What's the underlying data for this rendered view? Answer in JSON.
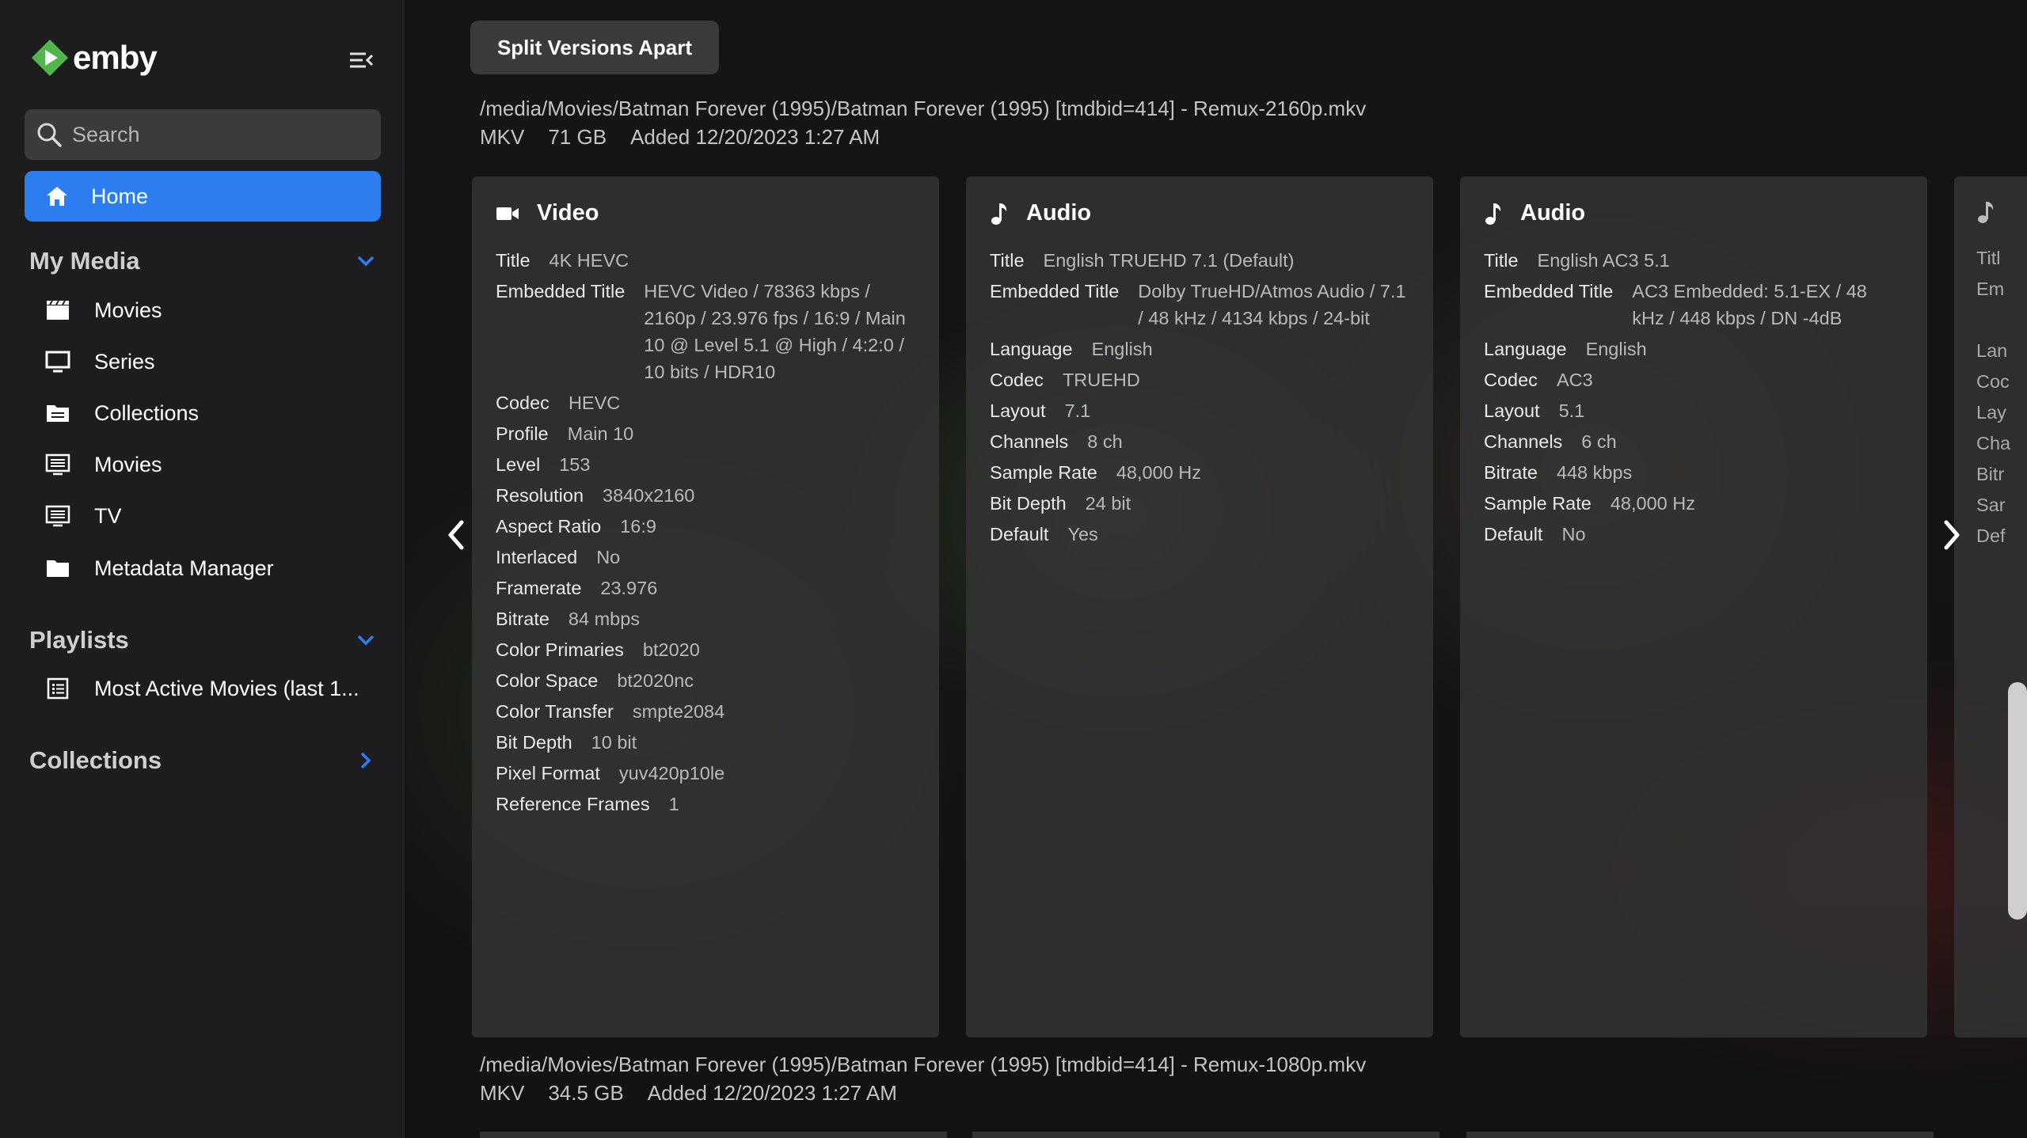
{
  "app": {
    "name": "emby",
    "accent": "#2c7df0",
    "logo_green": "#52b54b"
  },
  "sidebar": {
    "search_placeholder": "Search",
    "home_label": "Home",
    "my_media": {
      "title": "My Media",
      "items": [
        {
          "label": "Movies",
          "icon": "clapperboard-icon"
        },
        {
          "label": "Series",
          "icon": "monitor-icon"
        },
        {
          "label": "Collections",
          "icon": "folder-stack-icon"
        },
        {
          "label": "Movies",
          "icon": "list-box-icon"
        },
        {
          "label": "TV",
          "icon": "list-box-icon"
        },
        {
          "label": "Metadata Manager",
          "icon": "folder-icon"
        }
      ]
    },
    "playlists": {
      "title": "Playlists",
      "items": [
        {
          "label": "Most Active Movies (last 1...",
          "icon": "playlist-icon"
        }
      ]
    },
    "collections": {
      "title": "Collections"
    }
  },
  "main": {
    "split_button": "Split Versions Apart",
    "version1": {
      "path": "/media/Movies/Batman Forever (1995)/Batman Forever (1995) [tmdbid=414] - Remux-2160p.mkv",
      "container": "MKV",
      "size": "71 GB",
      "added": "Added 12/20/2023 1:27 AM"
    },
    "version2": {
      "path": "/media/Movies/Batman Forever (1995)/Batman Forever (1995) [tmdbid=414] - Remux-1080p.mkv",
      "container": "MKV",
      "size": "34.5 GB",
      "added": "Added 12/20/2023 1:27 AM"
    },
    "cards": [
      {
        "title": "Video",
        "rows": [
          [
            "Title",
            "4K HEVC"
          ],
          [
            "Embedded Title",
            "HEVC Video / 78363 kbps / 2160p / 23.976 fps / 16:9 / Main 10 @ Level 5.1 @ High / 4:2:0 / 10 bits / HDR10"
          ],
          [
            "Codec",
            "HEVC"
          ],
          [
            "Profile",
            "Main 10"
          ],
          [
            "Level",
            "153"
          ],
          [
            "Resolution",
            "3840x2160"
          ],
          [
            "Aspect Ratio",
            "16:9"
          ],
          [
            "Interlaced",
            "No"
          ],
          [
            "Framerate",
            "23.976"
          ],
          [
            "Bitrate",
            "84 mbps"
          ],
          [
            "Color Primaries",
            "bt2020"
          ],
          [
            "Color Space",
            "bt2020nc"
          ],
          [
            "Color Transfer",
            "smpte2084"
          ],
          [
            "Bit Depth",
            "10 bit"
          ],
          [
            "Pixel Format",
            "yuv420p10le"
          ],
          [
            "Reference Frames",
            "1"
          ]
        ]
      },
      {
        "title": "Audio",
        "rows": [
          [
            "Title",
            "English TRUEHD 7.1 (Default)"
          ],
          [
            "Embedded Title",
            "Dolby TrueHD/Atmos Audio / 7.1 / 48 kHz / 4134 kbps / 24-bit"
          ],
          [
            "Language",
            "English"
          ],
          [
            "Codec",
            "TRUEHD"
          ],
          [
            "Layout",
            "7.1"
          ],
          [
            "Channels",
            "8 ch"
          ],
          [
            "Sample Rate",
            "48,000 Hz"
          ],
          [
            "Bit Depth",
            "24 bit"
          ],
          [
            "Default",
            "Yes"
          ]
        ]
      },
      {
        "title": "Audio",
        "rows": [
          [
            "Title",
            "English AC3 5.1"
          ],
          [
            "Embedded Title",
            "AC3 Embedded: 5.1-EX / 48 kHz / 448 kbps / DN -4dB"
          ],
          [
            "Language",
            "English"
          ],
          [
            "Codec",
            "AC3"
          ],
          [
            "Layout",
            "5.1"
          ],
          [
            "Channels",
            "6 ch"
          ],
          [
            "Bitrate",
            "448 kbps"
          ],
          [
            "Sample Rate",
            "48,000 Hz"
          ],
          [
            "Default",
            "No"
          ]
        ]
      },
      {
        "title": "",
        "rows": [
          [
            "Titl",
            ""
          ],
          [
            "Em",
            ""
          ],
          [
            "",
            ""
          ],
          [
            "Lan",
            ""
          ],
          [
            "Coc",
            ""
          ],
          [
            "Lay",
            ""
          ],
          [
            "Cha",
            ""
          ],
          [
            "Bitr",
            ""
          ],
          [
            "Sar",
            ""
          ],
          [
            "Def",
            ""
          ]
        ]
      }
    ]
  }
}
